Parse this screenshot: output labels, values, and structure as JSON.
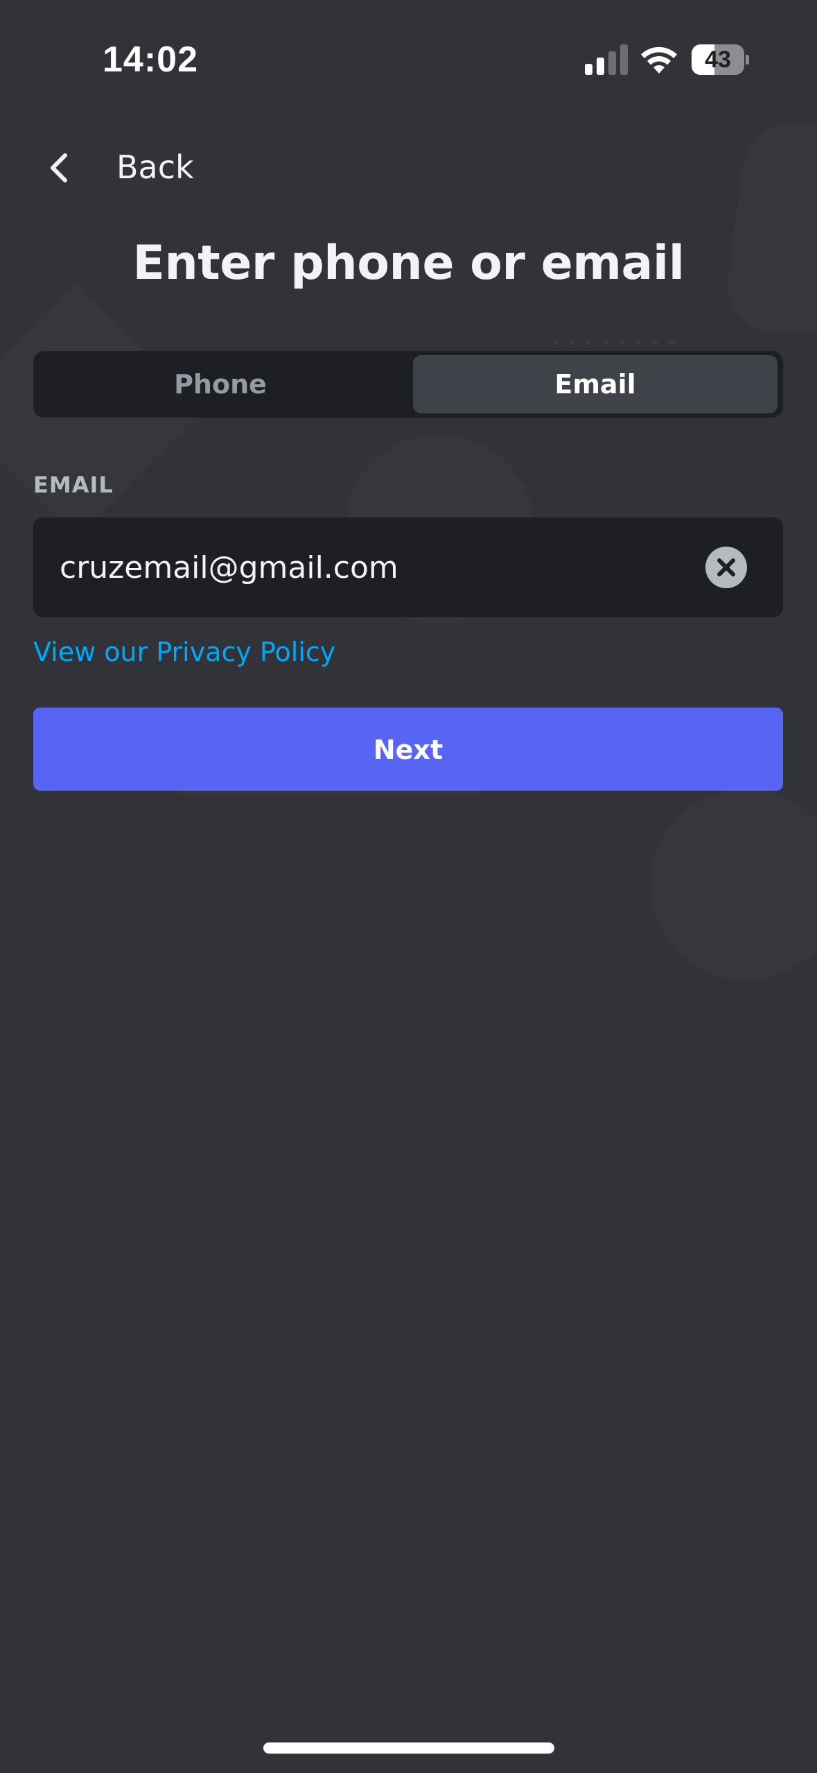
{
  "status_bar": {
    "time": "14:02",
    "battery": "43",
    "battery_level": 0.43,
    "signal_bars_active": 2,
    "signal_bars_total": 4,
    "icons": [
      "signal-icon",
      "wifi-icon",
      "battery-icon"
    ]
  },
  "nav": {
    "back_label": "Back",
    "back_icon": "chevron-left-icon"
  },
  "page": {
    "title": "Enter phone or email"
  },
  "tabs": {
    "phone_label": "Phone",
    "email_label": "Email",
    "selected": "Email"
  },
  "form": {
    "email_label": "EMAIL",
    "email_value": "cruzemail@gmail.com",
    "clear_icon": "close-circle-icon",
    "privacy_link": "View our Privacy Policy",
    "next_label": "Next"
  },
  "colors": {
    "background": "#313338",
    "input_background": "#1e1f22",
    "selected_tab": "#404249",
    "accent": "#5865f2",
    "link": "#00a8fc"
  }
}
